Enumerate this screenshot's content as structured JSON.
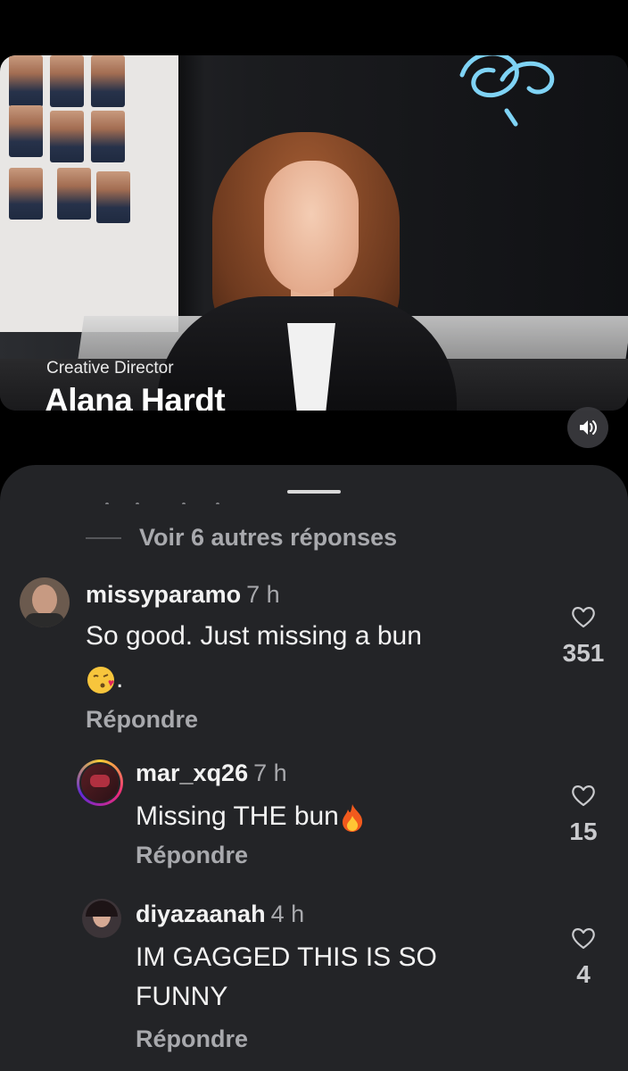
{
  "video": {
    "subtitle": "Creative Director",
    "title": "Alana Hardt",
    "sound_icon": "speaker-icon"
  },
  "sheet": {
    "more_replies": "Voir 6 autres réponses"
  },
  "comments": [
    {
      "username": "missyparamo",
      "time": "7 h",
      "text": "So good. Just missing a bun",
      "text_cont": ".",
      "emoji": "kiss-emoji",
      "reply_label": "Répondre",
      "likes": "351"
    },
    {
      "username": "mar_xq26",
      "time": "7 h",
      "text": "Missing THE bun",
      "emoji": "fire-emoji",
      "reply_label": "Répondre",
      "likes": "15"
    },
    {
      "username": "diyazaanah",
      "time": "4 h",
      "text": "IM GAGGED THIS IS SO",
      "text_cont": "FUNNY",
      "reply_label": "Répondre",
      "likes": "4"
    }
  ],
  "colors": {
    "background": "#000000",
    "sheet": "#232427",
    "secondary_text": "#a8a9ad",
    "neon": "#7fd3f5"
  }
}
